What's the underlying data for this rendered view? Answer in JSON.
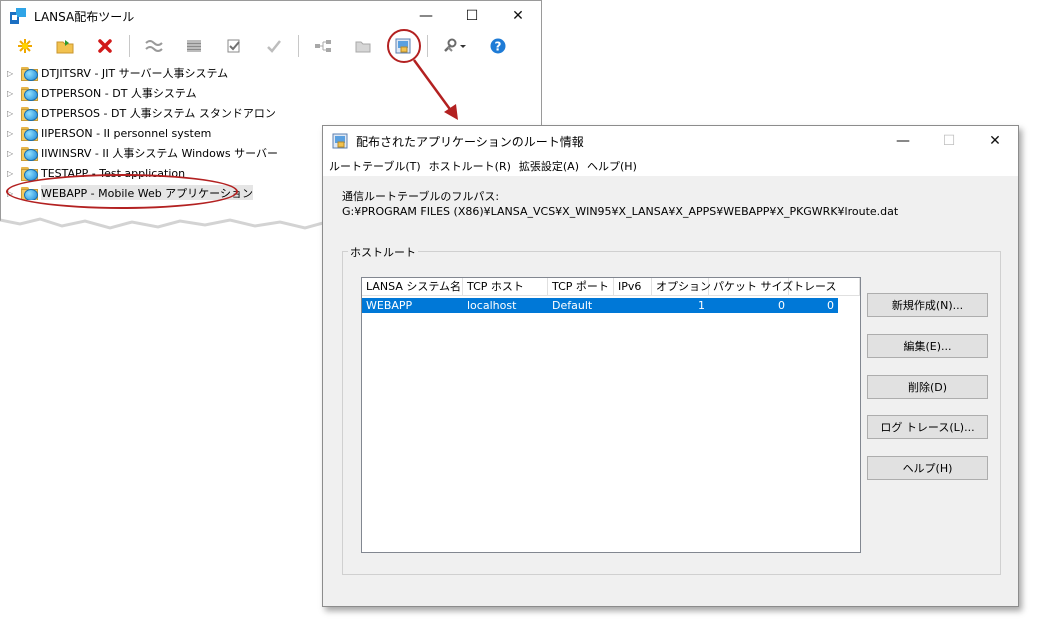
{
  "main_window": {
    "title": "LANSA配布ツール",
    "caption": {
      "minimize": "—",
      "maximize": "☐",
      "close": "✕"
    },
    "toolbar": [
      "new-star-icon",
      "open-folder-icon",
      "delete-x-icon",
      "sep",
      "compare-icon",
      "list-icon",
      "edit-check-icon",
      "checkmark-icon",
      "sep",
      "tree-icon",
      "folder-icon",
      "route-info-icon",
      "sep",
      "tools-icon",
      "help-icon"
    ],
    "tree_items": [
      {
        "label": "DTJITSRV - JIT サーバー人事システム"
      },
      {
        "label": "DTPERSON - DT 人事システム"
      },
      {
        "label": "DTPERSOS - DT 人事システム スタンドアロン"
      },
      {
        "label": "IIPERSON - II personnel system"
      },
      {
        "label": "IIWINSRV - II 人事システム Windows サーバー"
      },
      {
        "label": "TESTAPP - Test application"
      },
      {
        "label": "WEBAPP - Mobile Web アプリケーション",
        "selected": true
      }
    ]
  },
  "dialog": {
    "title": "配布されたアプリケーションのルート情報",
    "caption": {
      "minimize": "—",
      "maximize": "☐",
      "close": "✕"
    },
    "menus": [
      "ルートテーブル(T)",
      "ホストルート(R)",
      "拡張設定(A)",
      "ヘルプ(H)"
    ],
    "path_label": "通信ルートテーブルのフルパス:",
    "path_value": "G:¥PROGRAM FILES (X86)¥LANSA_VCS¥X_WIN95¥X_LANSA¥X_APPS¥WEBAPP¥X_PKGWRK¥lroute.dat",
    "group_label": "ホストルート",
    "columns": [
      "LANSA システム名",
      "TCP ホスト",
      "TCP ポート",
      "IPv6",
      "オプション",
      "パケット サイズ",
      "トレース"
    ],
    "rows": [
      [
        "WEBAPP",
        "localhost",
        "Default",
        "",
        "1",
        "0",
        "0"
      ]
    ],
    "buttons": {
      "new": "新規作成(N)...",
      "edit": "編集(E)...",
      "delete": "削除(D)",
      "log_trace": "ログ トレース(L)...",
      "help": "ヘルプ(H)"
    }
  }
}
